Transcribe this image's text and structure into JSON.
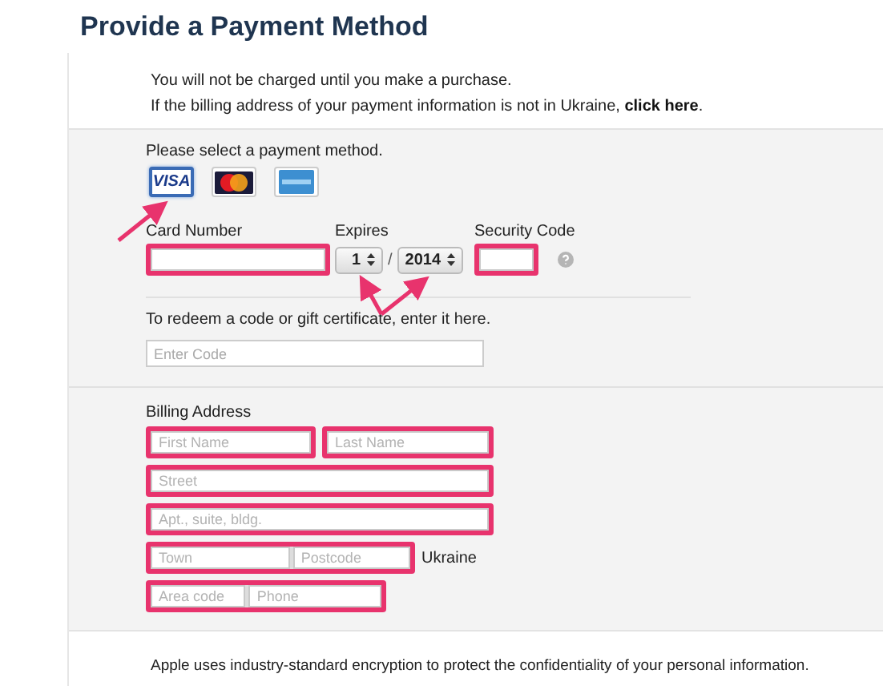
{
  "title": "Provide a Payment Method",
  "notice": {
    "line1": "You will not be charged until you make a purchase.",
    "line2_before": "If the billing address of your payment information is not in Ukraine, ",
    "link": "click here",
    "line2_after": "."
  },
  "payment": {
    "prompt": "Please select a payment method.",
    "cards": [
      {
        "kind": "visa",
        "label": "VISA",
        "selected": true
      },
      {
        "kind": "mastercard",
        "selected": false
      },
      {
        "kind": "amex",
        "selected": false
      }
    ]
  },
  "card_fields": {
    "card_number": {
      "label": "Card Number",
      "highlighted": true
    },
    "expires": {
      "label": "Expires",
      "month": "1",
      "separator": "/",
      "year": "2014"
    },
    "security_code": {
      "label": "Security Code",
      "highlighted": true
    }
  },
  "annotations": {
    "card_arrow": true,
    "expiry_arrows": true
  },
  "redeem": {
    "prompt": "To redeem a code or gift certificate, enter it here.",
    "placeholder": "Enter Code"
  },
  "billing": {
    "heading": "Billing Address",
    "rows": [
      {
        "groups": [
          {
            "highlighted": true,
            "placeholders": [
              "First Name"
            ]
          },
          {
            "highlighted": true,
            "placeholders": [
              "Last Name"
            ]
          }
        ]
      },
      {
        "groups": [
          {
            "highlighted": true,
            "placeholders": [
              "Street"
            ]
          }
        ]
      },
      {
        "groups": [
          {
            "highlighted": true,
            "placeholders": [
              "Apt., suite, bldg."
            ]
          }
        ]
      },
      {
        "groups": [
          {
            "highlighted": true,
            "placeholders": [
              "Town",
              "Postcode"
            ]
          }
        ],
        "country": "Ukraine"
      },
      {
        "groups": [
          {
            "highlighted": true,
            "placeholders": [
              "Area code",
              "Phone"
            ]
          }
        ]
      }
    ]
  },
  "footer": "Apple uses industry-standard encryption to protect the confidentiality of your personal information."
}
